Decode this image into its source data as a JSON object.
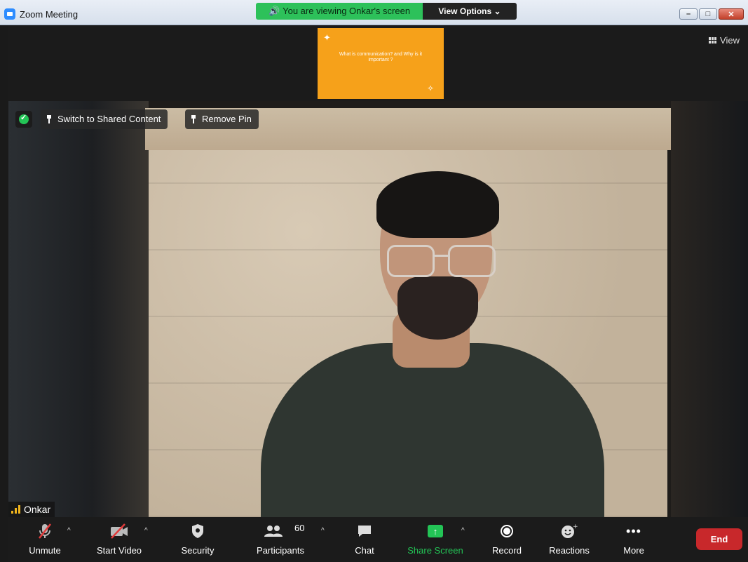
{
  "window": {
    "title": "Zoom Meeting"
  },
  "banner": {
    "viewing_text": "You are viewing Onkar's screen",
    "view_options": "View Options"
  },
  "strip": {
    "thumb_text": "What is communication? and Why is it important ?",
    "view_label": "View"
  },
  "overlay": {
    "switch_label": "Switch to Shared Content",
    "remove_pin_label": "Remove Pin",
    "participant_name": "Onkar"
  },
  "toolbar": {
    "unmute": "Unmute",
    "start_video": "Start Video",
    "security": "Security",
    "participants": "Participants",
    "participants_count": "60",
    "chat": "Chat",
    "share_screen": "Share Screen",
    "record": "Record",
    "reactions": "Reactions",
    "more": "More",
    "end": "End"
  },
  "colors": {
    "accent_green": "#23c456",
    "end_red": "#c8282b",
    "banner_green": "#2dc15a",
    "thumb_orange": "#f6a11a"
  },
  "icons": [
    "zoom-app-icon",
    "speaker-icon",
    "chevron-down-icon",
    "grid-view-icon",
    "shield-icon",
    "pin-icon",
    "signal-bars-icon",
    "mic-muted-icon",
    "video-off-icon",
    "security-shield-icon",
    "participants-icon",
    "chat-icon",
    "share-screen-icon",
    "record-icon",
    "reactions-icon",
    "more-dots-icon"
  ]
}
